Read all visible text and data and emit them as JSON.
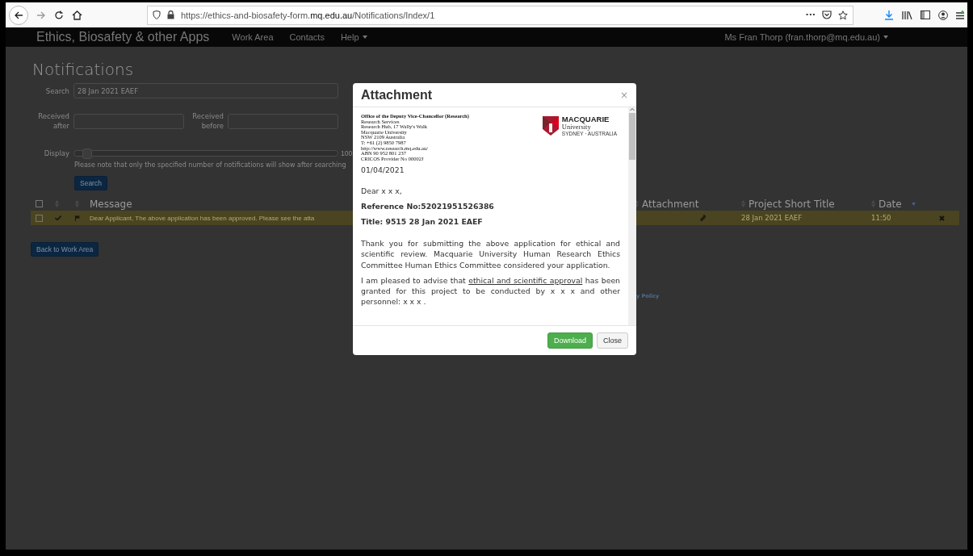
{
  "browser": {
    "url": "https://ethics-and-biosafety-form.**mq.edu.au**/Notifications/Index/1",
    "more": "···",
    "downloading": true
  },
  "navbar": {
    "brand": "Ethics, Biosafety & other Apps",
    "links": [
      {
        "label": "Work Area",
        "dropdown": false
      },
      {
        "label": "Contacts",
        "dropdown": false
      },
      {
        "label": "Help",
        "dropdown": true
      }
    ],
    "user": "Ms Fran Thorp (fran.thorp@mq.edu.au)"
  },
  "page": {
    "title": "Notifications",
    "search": {
      "label": "Search",
      "value": "28 Jan 2021 EAEF"
    },
    "received_after": {
      "label": "Received after"
    },
    "received_before": {
      "label": "Received before"
    },
    "display": {
      "label": "Display",
      "level": 0.03,
      "reading": "100"
    },
    "note": "Please note that only the specified number of notifications will show after searching",
    "search_button": "Search",
    "all_checked": false,
    "columns": [
      {
        "label": "Message"
      },
      {
        "label": "Attachment"
      },
      {
        "label": "Project Short Title"
      },
      {
        "label": "Date"
      }
    ],
    "rows": [
      {
        "checked": false,
        "read": true,
        "flagged": true,
        "message": "Dear Applicant, The above application has been approved. Please see the atta",
        "attachment": true,
        "project": "28 Jan 2021 EAEF",
        "date": "11:50",
        "highlighted": true
      }
    ],
    "back_button": "Back to Work Area",
    "footer_link": "y Policy"
  },
  "modal": {
    "title": "Attachment",
    "close": "×",
    "letterhead": {
      "office": "Office of the Deputy Vice-Chancellor (Research)",
      "address": [
        "Research Services",
        "Research Hub, 17 Wally's Walk",
        "Macquarie University",
        "NSW 2109 Australia",
        "T: +61 (2) 9850 7987",
        "http://www.research.mq.edu.au/",
        "ABN 90 952 801 237",
        "CRICOS Provider No 00002J"
      ],
      "logo_name": "MACQUARIE",
      "logo_sub": "University",
      "logo_place": "SYDNEY · AUSTRALIA"
    },
    "date": "01/04/2021",
    "greeting": "Dear x x x,",
    "reference": "Reference No:52021951526386",
    "letter_title": "Title: 9515 28 Jan 2021 EAEF",
    "paragraph": "Thank you for submitting the above application for ethical and scientific review. Macquarie University Human Research Ethics Committee Human Ethics Committee considered your application.",
    "approval": {
      "before": "I am pleased to advise that ",
      "link": "ethical and scientific approval",
      "after": " has been granted for this project to be conducted by x x x  and other personnel: x x x    ."
    },
    "buttons": [
      {
        "label": "Download",
        "kind": "primary"
      },
      {
        "label": "Close",
        "kind": "default"
      }
    ]
  }
}
